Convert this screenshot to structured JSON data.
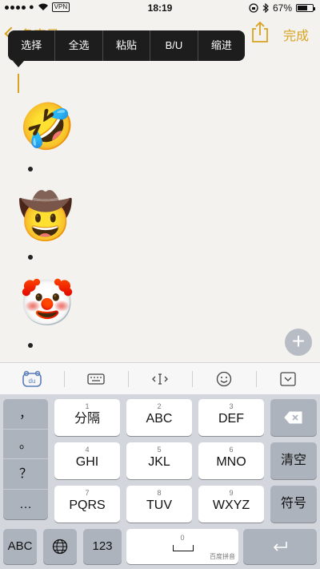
{
  "status_bar": {
    "vpn": "VPN",
    "time": "18:19",
    "battery_percent": "67%",
    "battery_level": 0.67
  },
  "nav": {
    "back_label": "备忘录",
    "done_label": "完成"
  },
  "edit_menu": {
    "items": [
      "选择",
      "全选",
      "粘贴",
      "B/U",
      "缩进"
    ]
  },
  "note": {
    "emojis": [
      "🤣",
      "🤠",
      "🤡"
    ]
  },
  "toolbar": {
    "icons": [
      "du-logo-icon",
      "keyboard-icon",
      "cursor-move-icon",
      "emoji-smiley-icon",
      "collapse-keyboard-icon"
    ]
  },
  "keyboard": {
    "punctuation": [
      "，",
      "。",
      "？",
      "…"
    ],
    "keys": [
      {
        "num": "1",
        "label": "分隔"
      },
      {
        "num": "2",
        "label": "ABC"
      },
      {
        "num": "3",
        "label": "DEF"
      },
      {
        "num": "4",
        "label": "GHI"
      },
      {
        "num": "5",
        "label": "JKL"
      },
      {
        "num": "6",
        "label": "MNO"
      },
      {
        "num": "7",
        "label": "PQRS"
      },
      {
        "num": "8",
        "label": "TUV"
      },
      {
        "num": "9",
        "label": "WXYZ"
      }
    ],
    "clear_label": "清空",
    "symbol_label": "符号",
    "abc_label": "ABC",
    "num_label": "123",
    "space_num": "0",
    "brand_label": "百度拼音",
    "accent_color": "#d9a321"
  }
}
